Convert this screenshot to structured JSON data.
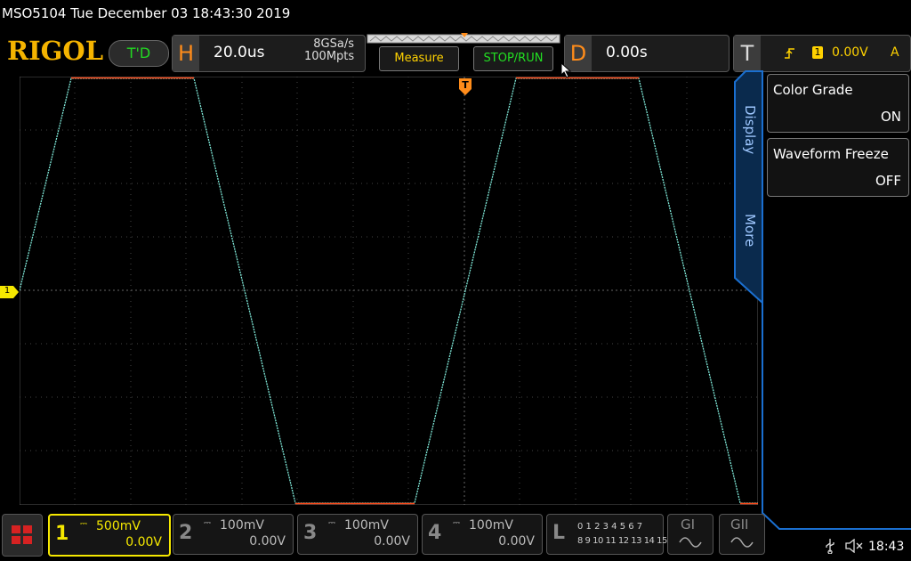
{
  "header": {
    "datetime": "MSO5104  Tue December 03 18:43:30 2019",
    "logo": "RIGOL",
    "trigger_status": "T'D"
  },
  "horizontal": {
    "letter": "H",
    "timebase": "20.0us",
    "sample_rate": "8GSa/s",
    "memory_depth": "100Mpts"
  },
  "buttons": {
    "measure": "Measure",
    "stop_run": "STOP/RUN"
  },
  "delay": {
    "letter": "D",
    "value": "0.00s"
  },
  "trigger": {
    "letter": "T",
    "channel_badge": "1",
    "level": "0.00V",
    "source": "A"
  },
  "side_menu": {
    "tab_display": "Display",
    "tab_more": "More",
    "items": [
      {
        "label": "Color Grade",
        "value": "ON"
      },
      {
        "label": "Waveform Freeze",
        "value": "OFF"
      }
    ]
  },
  "channels": [
    {
      "num": "1",
      "scale": "500mV",
      "offset": "0.00V",
      "active": true
    },
    {
      "num": "2",
      "scale": "100mV",
      "offset": "0.00V",
      "active": false
    },
    {
      "num": "3",
      "scale": "100mV",
      "offset": "0.00V",
      "active": false
    },
    {
      "num": "4",
      "scale": "100mV",
      "offset": "0.00V",
      "active": false
    }
  ],
  "logic": {
    "letter": "L",
    "row1": "0 1 2 3  4 5 6 7",
    "row2": "8 9 10 11 12 13 14 15"
  },
  "math": {
    "g1": "GI",
    "g2": "GII"
  },
  "grid_markers": {
    "ch1_marker": "1",
    "trigger_marker": "T"
  },
  "status": {
    "time": "18:43"
  },
  "colors": {
    "ch1": "#f5e800",
    "waveform": "#7fe8d8",
    "clip": "#ff4a1a",
    "accent": "#f5b400",
    "side_border": "#1a6fd0"
  },
  "icons": {
    "usb": "usb-icon",
    "mute": "speaker-muted-icon",
    "menu": "menu-grid-icon"
  }
}
